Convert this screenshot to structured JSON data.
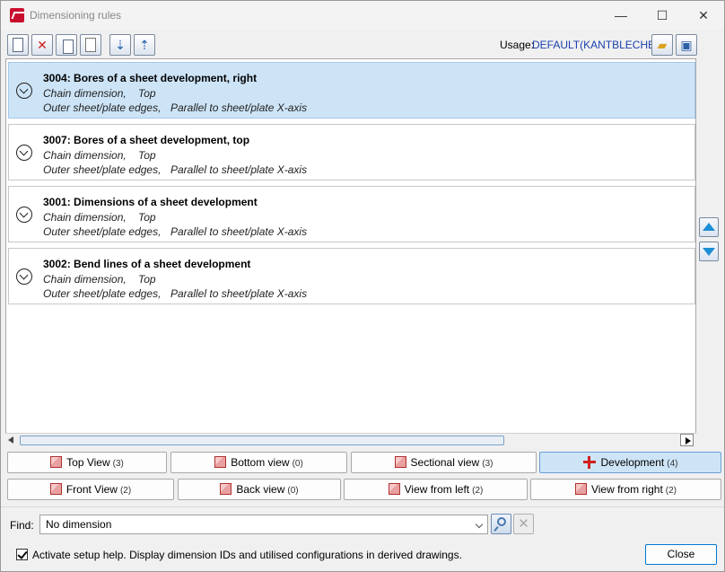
{
  "window": {
    "title": "Dimensioning rules",
    "minimize": "—",
    "maximize": "☐",
    "close": "✕"
  },
  "toolbar": {
    "buttons": [
      {
        "name": "new-doc-icon"
      },
      {
        "name": "delete-icon",
        "glyph": "✕"
      },
      {
        "name": "copy-icon"
      },
      {
        "name": "paste-icon"
      },
      {
        "name": "sort-down-icon"
      },
      {
        "name": "sort-up-icon"
      }
    ],
    "usage_label": "Usage:",
    "usage_value": "DEFAULT(KANTBLECHE)"
  },
  "rules": [
    {
      "id": "3004",
      "title": "Bores of a sheet development, right",
      "type": "Chain dimension,",
      "side": "Top",
      "edges": "Outer sheet/plate edges,",
      "orientation": "Parallel to sheet/plate X-axis",
      "selected": true
    },
    {
      "id": "3007",
      "title": "Bores of a sheet development, top",
      "type": "Chain dimension,",
      "side": "Top",
      "edges": "Outer sheet/plate edges,",
      "orientation": "Parallel to sheet/plate X-axis",
      "selected": false
    },
    {
      "id": "3001",
      "title": "Dimensions of a sheet development",
      "type": "Chain dimension,",
      "side": "Top",
      "edges": "Outer sheet/plate edges,",
      "orientation": "Parallel to sheet/plate X-axis",
      "selected": false
    },
    {
      "id": "3002",
      "title": "Bend lines of a sheet development",
      "type": "Chain dimension,",
      "side": "Top",
      "edges": "Outer sheet/plate edges,",
      "orientation": "Parallel to sheet/plate X-axis",
      "selected": false
    }
  ],
  "view_tabs_row1": [
    {
      "label": "Top View",
      "count": "(3)",
      "active": false
    },
    {
      "label": "Bottom view",
      "count": "(0)",
      "active": false
    },
    {
      "label": "Sectional view",
      "count": "(3)",
      "active": false
    },
    {
      "label": "Development",
      "count": "(4)",
      "active": true
    }
  ],
  "view_tabs_row2": [
    {
      "label": "Front View",
      "count": "(2)",
      "active": false
    },
    {
      "label": "Back view",
      "count": "(0)",
      "active": false
    },
    {
      "label": "View from left",
      "count": "(2)",
      "active": false
    },
    {
      "label": "View from right",
      "count": "(2)",
      "active": false
    }
  ],
  "find": {
    "label": "Find:",
    "value": "No dimension"
  },
  "setup_help": {
    "checked": true,
    "label": "Activate setup help. Display dimension IDs and utilised configurations in derived drawings."
  },
  "close_label": "Close",
  "colors": {
    "selected_row": "#cde4f7",
    "usage_value": "#1a3fae",
    "scroll_arrow": "#1e8fd6"
  }
}
